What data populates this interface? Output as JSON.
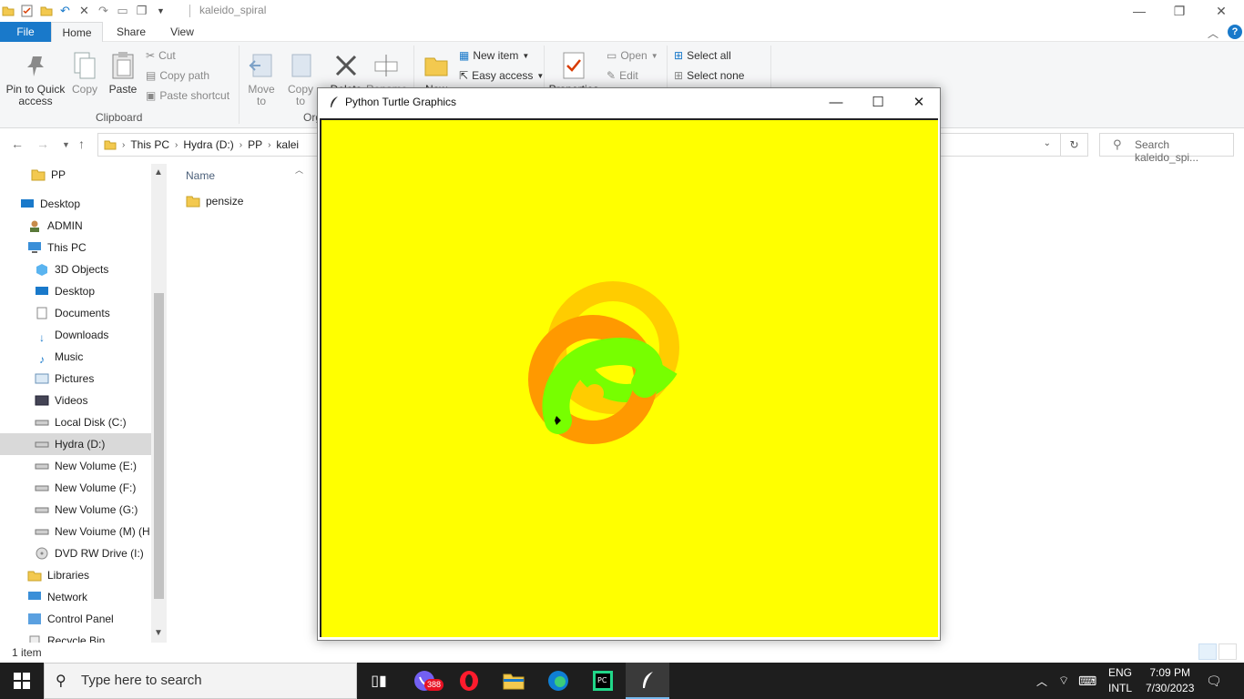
{
  "explorer": {
    "title": "kaleido_spiral",
    "tabs": {
      "file": "File",
      "home": "Home",
      "share": "Share",
      "view": "View"
    },
    "ribbon": {
      "pin_quick_access": "Pin to Quick access",
      "copy": "Copy",
      "paste": "Paste",
      "cut": "Cut",
      "copy_path": "Copy path",
      "paste_shortcut": "Paste shortcut",
      "clipboard_group": "Clipboard",
      "move_to": "Move to",
      "copy_to": "Copy to",
      "organize_group": "Org",
      "delete": "Delete",
      "rename": "Rename",
      "new": "New",
      "new_item": "New item",
      "easy_access": "Easy access",
      "properties": "Properties",
      "open": "Open",
      "edit": "Edit",
      "select_all": "Select all",
      "select_none": "Select none"
    },
    "breadcrumbs": [
      "This PC",
      "Hydra (D:)",
      "PP",
      "kalei"
    ],
    "search_placeholder": "Search kaleido_spi...",
    "nav": [
      {
        "label": "PP",
        "icon": "folder-icon"
      },
      {
        "label": "Desktop",
        "icon": "desktop-icon"
      },
      {
        "label": "ADMIN",
        "icon": "user-icon"
      },
      {
        "label": "This PC",
        "icon": "pc-icon"
      },
      {
        "label": "3D Objects",
        "icon": "cube-icon"
      },
      {
        "label": "Desktop",
        "icon": "desktop-icon"
      },
      {
        "label": "Documents",
        "icon": "document-icon"
      },
      {
        "label": "Downloads",
        "icon": "download-icon"
      },
      {
        "label": "Music",
        "icon": "music-icon"
      },
      {
        "label": "Pictures",
        "icon": "picture-icon"
      },
      {
        "label": "Videos",
        "icon": "video-icon"
      },
      {
        "label": "Local Disk (C:)",
        "icon": "drive-icon"
      },
      {
        "label": "Hydra (D:)",
        "icon": "drive-icon"
      },
      {
        "label": "New Volume (E:)",
        "icon": "drive-icon"
      },
      {
        "label": "New Volume (F:)",
        "icon": "drive-icon"
      },
      {
        "label": "New Volume (G:)",
        "icon": "drive-icon"
      },
      {
        "label": "New Voiume (M) (H",
        "icon": "drive-icon"
      },
      {
        "label": "DVD RW Drive (I:)",
        "icon": "dvd-icon"
      },
      {
        "label": "Libraries",
        "icon": "library-icon"
      },
      {
        "label": "Network",
        "icon": "network-icon"
      },
      {
        "label": "Control Panel",
        "icon": "control-panel-icon"
      },
      {
        "label": "Recycle Bin",
        "icon": "recycle-bin-icon"
      }
    ],
    "column_name": "Name",
    "files": [
      {
        "name": "pensize",
        "icon": "folder-icon"
      }
    ],
    "status": "1 item"
  },
  "turtle_window": {
    "title": "Python Turtle Graphics",
    "canvas_color": "#ffff00",
    "shape_colors": [
      "#ff9900",
      "#ffcc00",
      "#77ff00"
    ]
  },
  "taskbar": {
    "search_placeholder": "Type here to search",
    "viber_badge": "388",
    "language": "ENG",
    "layout": "INTL",
    "time": "7:09 PM",
    "date": "7/30/2023"
  },
  "colors": {
    "accent": "#1979ca",
    "taskbar": "#1e1e1e"
  }
}
